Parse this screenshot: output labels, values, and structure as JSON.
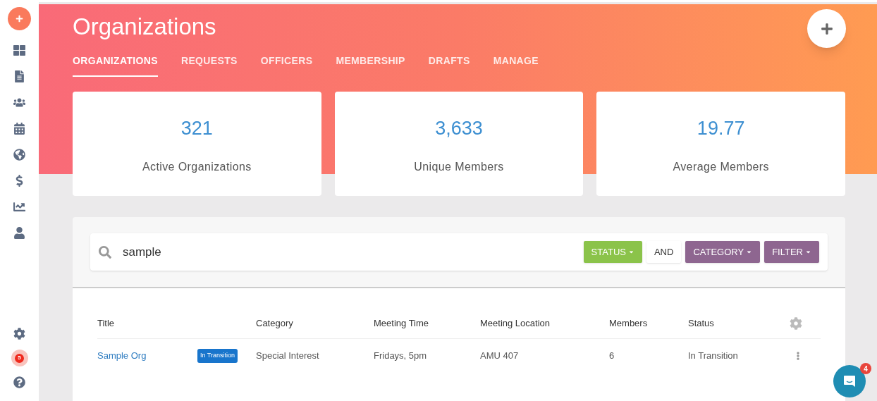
{
  "sidebar": {
    "notification_count": "5"
  },
  "header": {
    "title": "Organizations"
  },
  "tabs": [
    {
      "label": "ORGANIZATIONS",
      "selected": true
    },
    {
      "label": "REQUESTS",
      "selected": false
    },
    {
      "label": "OFFICERS",
      "selected": false
    },
    {
      "label": "MEMBERSHIP",
      "selected": false
    },
    {
      "label": "DRAFTS",
      "selected": false
    },
    {
      "label": "MANAGE",
      "selected": false
    }
  ],
  "stats": [
    {
      "value": "321",
      "label": "Active Organizations"
    },
    {
      "value": "3,633",
      "label": "Unique Members"
    },
    {
      "value": "19.77",
      "label": "Average Members"
    }
  ],
  "search": {
    "value": "sample"
  },
  "filters": [
    {
      "label": "STATUS",
      "dropdown": true,
      "color": "#8bc34a"
    },
    {
      "label": "AND",
      "dropdown": false,
      "color": "#ffffff"
    },
    {
      "label": "CATEGORY",
      "dropdown": true,
      "color": "#8e6690"
    },
    {
      "label": "FILTER",
      "dropdown": true,
      "color": "#8e6690"
    }
  ],
  "table": {
    "columns": [
      "Title",
      "Category",
      "Meeting Time",
      "Meeting Location",
      "Members",
      "Status"
    ],
    "rows": [
      {
        "title": "Sample Org",
        "badge": "In Transition",
        "category": "Special Interest",
        "meeting_time": "Fridays, 5pm",
        "meeting_location": "AMU 407",
        "members": "6",
        "status": "In Transition"
      }
    ]
  },
  "chat": {
    "badge": "4"
  }
}
